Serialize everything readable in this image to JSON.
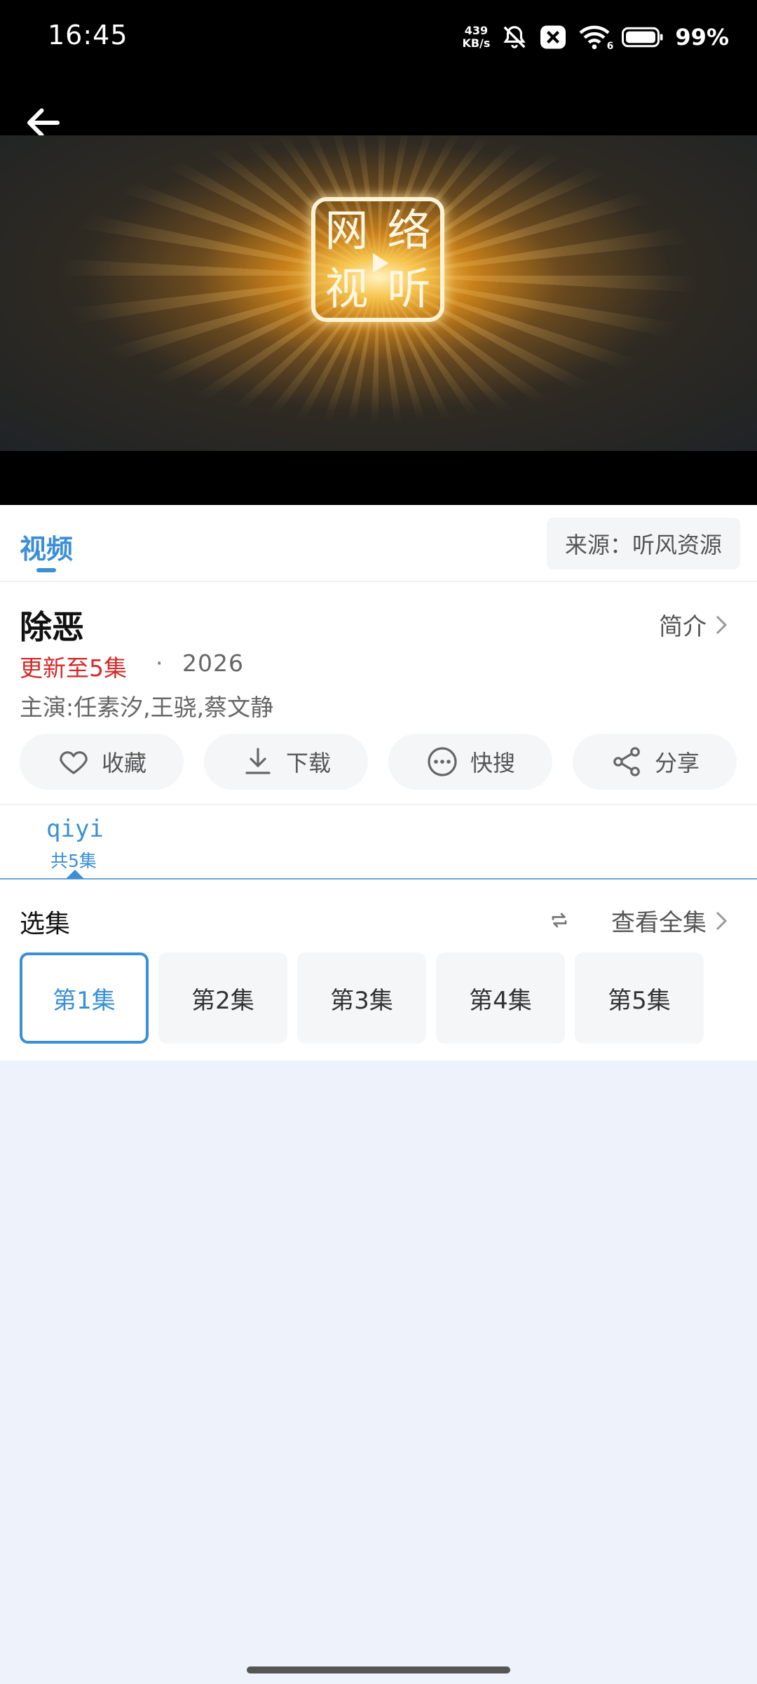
{
  "status_bar": {
    "time": "16:45",
    "net_speed_value": "439",
    "net_speed_unit": "KB/s",
    "wifi_badge": "6",
    "battery": "99%"
  },
  "player": {
    "logo_chars": [
      "网",
      "络",
      "视",
      "听"
    ]
  },
  "header": {
    "tab_label": "视频",
    "source": "来源：听风资源"
  },
  "show": {
    "title": "除恶",
    "intro_label": "简介",
    "update_status": "更新至5集",
    "separator": "·",
    "year": "2026",
    "cast": "主演:任素汐,王骁,蔡文静"
  },
  "actions": [
    {
      "label": "收藏",
      "icon": "heart-icon"
    },
    {
      "label": "下载",
      "icon": "download-icon"
    },
    {
      "label": "快搜",
      "icon": "more-dots-icon"
    },
    {
      "label": "分享",
      "icon": "share-icon"
    }
  ],
  "lines": {
    "name": "qiyi",
    "count": "共5集"
  },
  "episodes": {
    "title": "选集",
    "view_all": "查看全集",
    "items": [
      "第1集",
      "第2集",
      "第3集",
      "第4集",
      "第5集"
    ],
    "selected_index": 0
  },
  "colors": {
    "accent": "#3a8fd6",
    "update_red": "#d42a2a",
    "chip_bg": "#f4f5f7",
    "page_bg": "#eef3fb"
  }
}
